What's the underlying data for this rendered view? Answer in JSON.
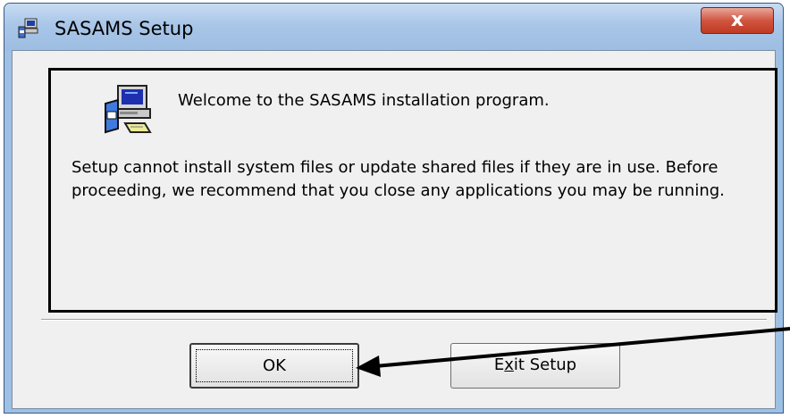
{
  "window": {
    "title": "SASAMS Setup",
    "close_label": "x"
  },
  "content": {
    "welcome": "Welcome to the SASAMS installation program.",
    "warning": "Setup cannot install system files or update shared files if they are in use. Before proceeding, we recommend that you close any applications you may be running."
  },
  "buttons": {
    "ok_label": "OK",
    "exit_label": "Exit Setup",
    "exit_mnemonic": "x"
  },
  "icons": {
    "title": "setup-app-icon",
    "main": "computer-setup-icon",
    "annotation": "arrow-pointer"
  },
  "colors": {
    "titlebar": "#a9c6e8",
    "close_button": "#d0553f",
    "client_background": "#f0f0f0"
  }
}
